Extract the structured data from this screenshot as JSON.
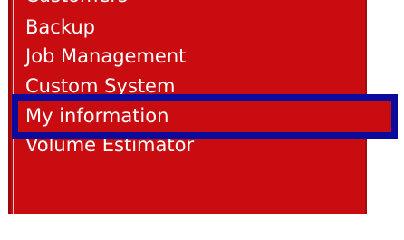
{
  "menu": {
    "items": [
      {
        "label": "Customers",
        "partial": true
      },
      {
        "label": "Backup"
      },
      {
        "label": "Job Management"
      },
      {
        "label": "Custom System"
      },
      {
        "label": "My information",
        "highlighted": true
      },
      {
        "label": "Volume Estimator"
      }
    ]
  },
  "colors": {
    "menu_background": "#c80c0f",
    "menu_text": "#ffffff",
    "highlight_border": "#0a0a9c",
    "page_background": "#ffffff"
  }
}
